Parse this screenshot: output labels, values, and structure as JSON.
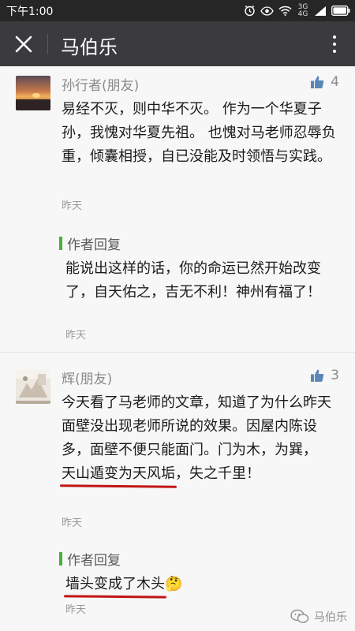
{
  "status_bar": {
    "time": "下午1:00",
    "network": "3G 4G",
    "icons": [
      "alarm-icon",
      "eye-icon",
      "wifi-icon",
      "signal-icon",
      "battery-icon"
    ]
  },
  "header": {
    "title": "马伯乐",
    "close_icon": "close-icon",
    "more_icon": "more-icon"
  },
  "comments": [
    {
      "nickname": "孙行者(朋友)",
      "likes": "4",
      "text": "易经不灭，则中华不灭。 作为一个华夏子孙，我愧对华夏先祖。 也愧对马老师忍辱负重，倾囊相授，自已没能及时领悟与实践。",
      "time": "昨天",
      "reply": {
        "label": "作者回复",
        "text": "能说出这样的话，你的命运已然开始改变了，自天佑之，吉无不利！神州有福了！",
        "time": "昨天"
      }
    },
    {
      "nickname": "辉(朋友)",
      "likes": "3",
      "text_before": "今天看了马老师的文章，知道了为什么昨天面壁没出现老师所说的效果。因屋内陈设多，面壁不便只能面门。门为木，为巽，",
      "text_highlight": "天山遁变为天风垢",
      "text_after": "，失之千里！",
      "time": "昨天",
      "reply": {
        "label": "作者回复",
        "text_highlight": "墙头变成了木头",
        "emoji": "🤔",
        "time": "昨天"
      }
    }
  ],
  "watermark": {
    "text": "马伯乐",
    "icon": "wechat-icon"
  },
  "colors": {
    "header_bg": "#3a3a3f",
    "status_bg": "#262626",
    "reply_bar": "#45b139",
    "like_icon": "#5b87b7",
    "annotation_red": "#c21516"
  }
}
